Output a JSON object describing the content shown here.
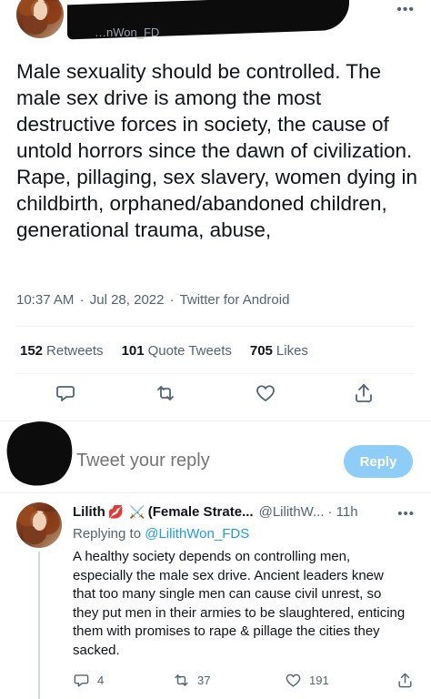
{
  "tweet": {
    "handle_remnant": "…nWon_FD",
    "more_icon": "more-horizontal-icon",
    "text": "Male sexuality should be controlled. The male sex drive is among the most destructive forces in society, the cause of untold horrors since the dawn of civilization. Rape, pillaging, sex slavery, women dying in childbirth, orphaned/abandoned children, generational trauma, abuse,",
    "time": "10:37 AM",
    "dot1": "·",
    "date": "Jul 28, 2022",
    "dot2": "·",
    "source": "Twitter for Android",
    "retweets_count": "152",
    "retweets_label": "Retweets",
    "quotes_count": "101",
    "quotes_label": "Quote Tweets",
    "likes_count": "705",
    "likes_label": "Likes"
  },
  "reply_box": {
    "placeholder": "Tweet your reply",
    "button_label": "Reply",
    "button_color": "#8ecdf8"
  },
  "reply": {
    "name": "Lilith",
    "emoji_1": "💋",
    "emoji_2": "⚔️",
    "name_suffix": "(Female Strate...",
    "handle": "@LilithW...",
    "time": "· 11h",
    "replying_prefix": "Replying to",
    "replying_to": "@LilithWon_FDS",
    "body": "A healthy society depends on controlling men, especially the male sex drive. Ancient leaders knew that too many single men can cause civil unrest, so they put men in their armies to be slaughtered, enticing them with promises to rape & pillage the cities they sacked.",
    "reply_count": "4",
    "retweet_count": "37",
    "like_count": "191"
  },
  "colors": {
    "text_primary": "#0f1419",
    "text_secondary": "#536471",
    "link": "#1d9bf0",
    "border": "#eff3f4"
  }
}
